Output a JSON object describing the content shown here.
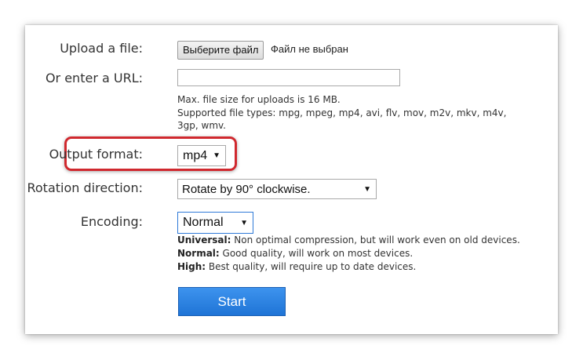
{
  "form": {
    "upload": {
      "label": "Upload a file:",
      "button_label": "Выберите файл",
      "status": "Файл не выбран"
    },
    "url": {
      "label": "Or enter a URL:",
      "value": ""
    },
    "limits": {
      "size_note": "Max. file size for uploads is 16 MB.",
      "types_note_line1": "Supported file types: mpg, mpeg, mp4, avi, flv, mov, m2v, mkv, m4v,",
      "types_note_line2": "3gp, wmv."
    },
    "output_format": {
      "label": "Output format:",
      "selected": "mp4"
    },
    "rotation": {
      "label": "Rotation direction:",
      "selected": "Rotate by 90° clockwise."
    },
    "encoding": {
      "label": "Encoding:",
      "selected": "Normal",
      "descriptions": [
        {
          "name": "Universal:",
          "text": " Non optimal compression, but will work even on old devices."
        },
        {
          "name": "Normal:",
          "text": " Good quality, will work on most devices."
        },
        {
          "name": "High:",
          "text": " Best quality, will require up to date devices."
        }
      ]
    },
    "start_label": "Start"
  },
  "colors": {
    "highlight": "#d0282e",
    "button": "#2a84e6"
  },
  "icons": {
    "dropdown": "triangle-down-icon"
  }
}
